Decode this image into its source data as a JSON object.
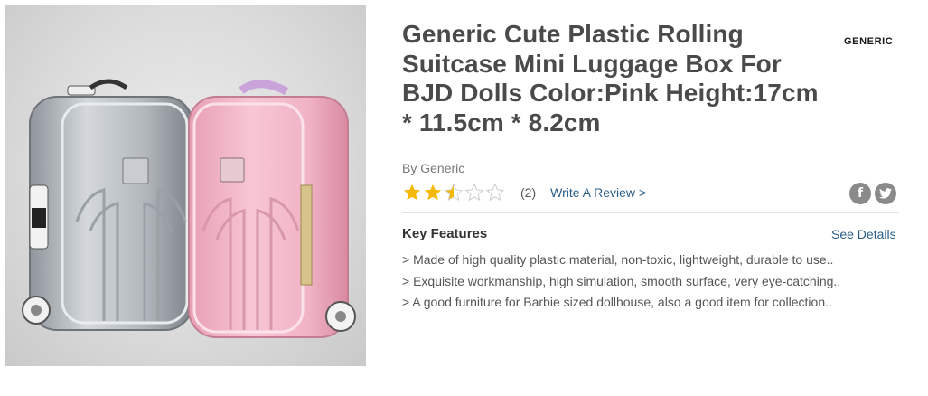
{
  "product": {
    "title": "Generic Cute Plastic Rolling Suitcase Mini Luggage Box For BJD Dolls Color:Pink Height:17cm * 11.5cm * 8.2cm",
    "brand_logo": "GENERIC",
    "byline": "By Generic",
    "rating": {
      "value": 2.5,
      "max": 5,
      "count_label": "(2)"
    },
    "write_review_label": "Write A Review >",
    "share_icons": [
      "facebook-icon",
      "twitter-icon"
    ]
  },
  "key_features": {
    "header": "Key Features",
    "see_details_label": "See Details",
    "items": [
      "> Made of high quality plastic material, non-toxic, lightweight, durable to use..",
      "> Exquisite workmanship, high simulation, smooth surface, very eye-catching..",
      "> A good furniture for Barbie sized dollhouse, also a good item for collection.."
    ]
  },
  "colors": {
    "star_filled": "#f5b800",
    "star_empty": "#cfcfcf",
    "link": "#2a5d8a",
    "title": "#4a4a4a"
  }
}
